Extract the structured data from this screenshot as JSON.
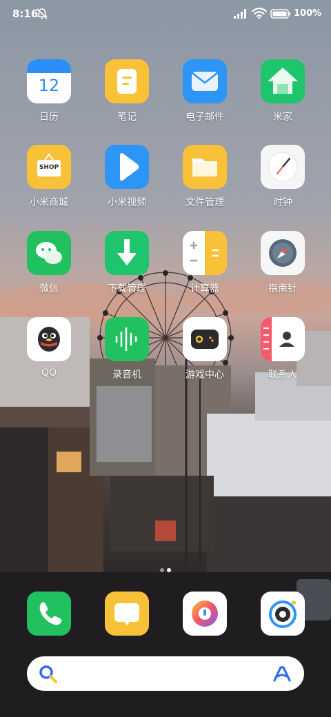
{
  "status_bar": {
    "time": "8:16",
    "battery_percent": "100%",
    "icons": [
      "mute-bell-icon",
      "signal-icon",
      "wifi-icon",
      "battery-icon"
    ]
  },
  "apps": [
    {
      "label": "日历",
      "icon": "calendar-icon",
      "date": "12"
    },
    {
      "label": "笔记",
      "icon": "notes-icon"
    },
    {
      "label": "电子邮件",
      "icon": "mail-icon"
    },
    {
      "label": "米家",
      "icon": "home-icon"
    },
    {
      "label": "小米商城",
      "icon": "shop-icon",
      "badge_text": "SHOP"
    },
    {
      "label": "小米视频",
      "icon": "play-icon"
    },
    {
      "label": "文件管理",
      "icon": "folder-icon"
    },
    {
      "label": "时钟",
      "icon": "clock-icon"
    },
    {
      "label": "微信",
      "icon": "wechat-icon"
    },
    {
      "label": "下载管理",
      "icon": "download-icon"
    },
    {
      "label": "计算器",
      "icon": "calculator-icon"
    },
    {
      "label": "指南针",
      "icon": "compass-icon"
    },
    {
      "label": "QQ",
      "icon": "qq-penguin-icon"
    },
    {
      "label": "录音机",
      "icon": "recorder-icon"
    },
    {
      "label": "游戏中心",
      "icon": "gamepad-icon"
    },
    {
      "label": "联系人",
      "icon": "contacts-icon"
    }
  ],
  "dock": [
    {
      "icon": "phone-icon"
    },
    {
      "icon": "messages-icon"
    },
    {
      "icon": "music-icon"
    },
    {
      "icon": "camera-icon"
    }
  ],
  "page_indicator": {
    "pages": 2,
    "current": 2
  },
  "search": {
    "icons": [
      "search-icon",
      "assistant-icon"
    ]
  },
  "colors": {
    "calendar_blue": "#2c8ff7",
    "notes_yellow": "#f8c138",
    "mail_blue": "#2d95f5",
    "home_green": "#1ec56c",
    "wechat_green": "#20c15e",
    "contacts_red": "#f55a6d"
  }
}
